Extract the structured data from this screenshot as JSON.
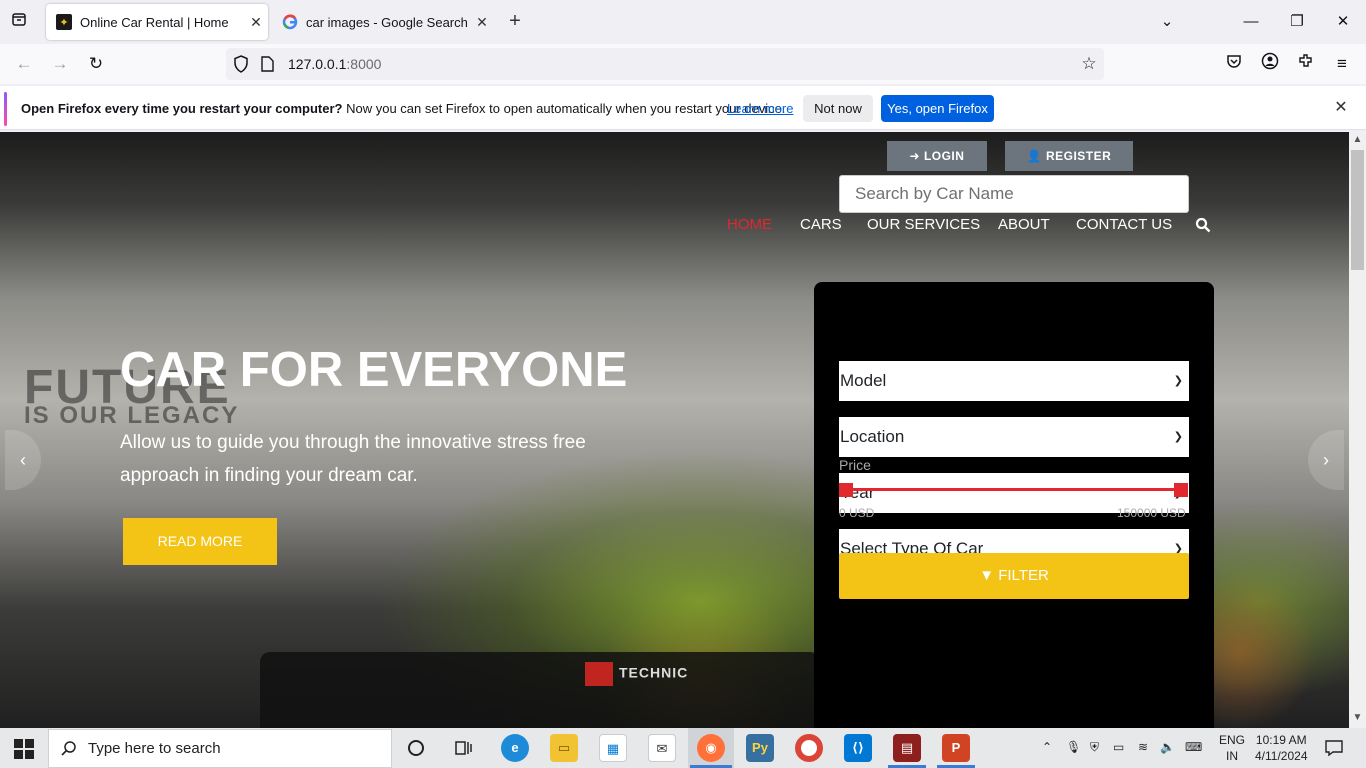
{
  "browser": {
    "tabs": [
      {
        "title": "Online Car Rental | Home",
        "active": true
      },
      {
        "title": "car images - Google Search",
        "active": false
      }
    ],
    "url_host": "127.0.0.1",
    "url_port": ":8000"
  },
  "notification": {
    "bold": "Open Firefox every time you restart your computer?",
    "text": " Now you can set Firefox to open automatically when you restart your device.",
    "link": "Learn more",
    "not_now": "Not now",
    "yes": "Yes, open Firefox"
  },
  "site": {
    "login": "LOGIN",
    "register": "REGISTER",
    "menu": [
      "HOME",
      "CARS",
      "OUR SERVICES",
      "ABOUT",
      "CONTACT US"
    ],
    "hero_title": "CAR FOR EVERYONE",
    "hero_sub": "Allow us to guide you through the innovative stress free approach in finding your dream car.",
    "read_more": "READ MORE",
    "search_placeholder": "Search by Car Name",
    "selects": [
      "Model",
      "Location",
      "Year",
      "Select Type Of Car"
    ],
    "price_label": "Price",
    "price_min": "0 USD",
    "price_max": "150000 USD",
    "price_range_fraction": [
      0,
      1
    ],
    "filter": "FILTER"
  },
  "taskbar": {
    "search_placeholder": "Type here to search",
    "lang": "ENG",
    "region": "IN",
    "time": "10:19 AM",
    "date": "4/11/2024"
  },
  "colors": {
    "accent_red": "#e0282e",
    "accent_yellow": "#f3c316",
    "firefox_blue": "#0061e0"
  }
}
